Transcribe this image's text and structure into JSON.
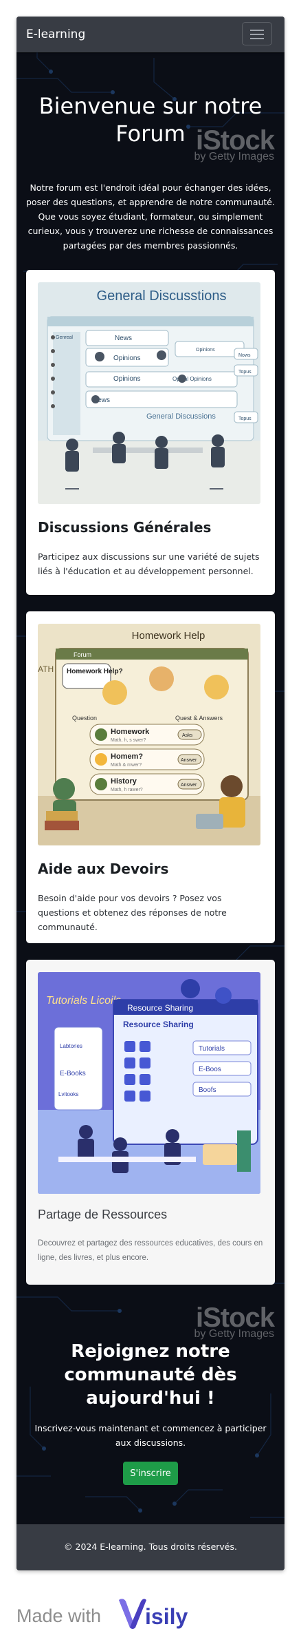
{
  "navbar": {
    "brand": "E-learning",
    "toggle_icon": "hamburger-menu-icon"
  },
  "hero": {
    "title": "Bienvenue sur notre Forum",
    "text": "Notre forum est l'endroit idéal pour échanger des idées, poser des questions, et apprendre de notre communauté. Que vous soyez étudiant, formateur, ou simplement curieux, vous y trouverez une richesse de connaissances partagées par des membres passionnés.",
    "watermark_brand": "iStock",
    "watermark_sub": "by Getty Images"
  },
  "cards": [
    {
      "title": "Discussions Générales",
      "text": "Participez aux discussions sur une variété de sujets liés à l'éducation et au développement personnel.",
      "image": {
        "heading": "General Discusstions",
        "labels": [
          "News",
          "Opinions",
          "Opinions",
          "News",
          "Genreal",
          "Opinions",
          "Opiual Opinions",
          "Nows",
          "Topus",
          "Topus",
          "General Discussions"
        ]
      }
    },
    {
      "title": "Aide aux Devoirs",
      "text": "Besoin d'aide pour vos devoirs ? Posez vos questions et obtenez des réponses de notre communauté.",
      "image": {
        "heading": "Homework Help",
        "forum_label": "Forum",
        "bubble": "Homework Help?",
        "question_label": "Question",
        "answers_label": "Quest & Answers",
        "rows": [
          {
            "title": "Homework",
            "sub": "Math, h, s swer?",
            "tag": "Asks"
          },
          {
            "title": "Homem?",
            "sub": "Math & mwer?",
            "tag": "Answer"
          },
          {
            "title": "History",
            "sub": "Math, h rawer?",
            "tag": "Answer"
          }
        ],
        "side_label": "ATH"
      }
    },
    {
      "title": "Partage de Ressources",
      "text": "Decouvrez et partagez des ressources educatives, des cours en ligne, des livres, et plus encore.",
      "image": {
        "left_title": "Tutorials Licoils",
        "panel_title": "Resource Sharing",
        "panel_sub": "Resource Sharing",
        "items": [
          "Tutorials",
          "E-Boos",
          "Boofs",
          "E-Books",
          "Labtories",
          "Lvitooks"
        ]
      }
    }
  ],
  "cta": {
    "title": "Rejoignez notre communauté dès aujourd'hui !",
    "text": "Inscrivez-vous maintenant et commencez à participer aux discussions.",
    "button": "S'inscrire"
  },
  "footer": {
    "text": "© 2024 E-learning. Tous droits réservés."
  },
  "badge": {
    "made_with": "Made with",
    "brand": "isily"
  },
  "colors": {
    "navbar": "#383c44",
    "background": "#0b0e16",
    "button": "#1e9c48",
    "visily": "#3a3fb5"
  }
}
